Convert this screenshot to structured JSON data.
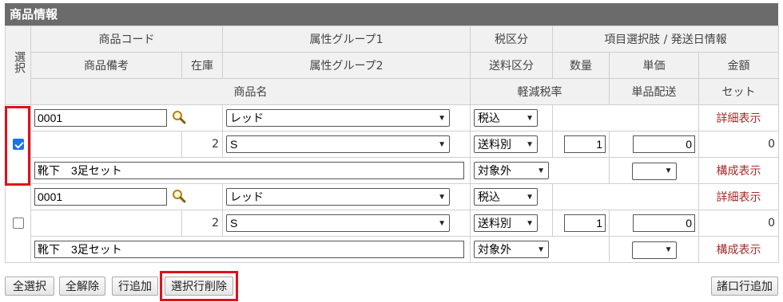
{
  "section_title": "商品情報",
  "headers": {
    "select": "選択",
    "product_code": "商品コード",
    "attr_group1": "属性グループ1",
    "tax_class": "税区分",
    "option_info": "項目選択肢 / 発送日情報",
    "product_note": "商品備考",
    "stock": "在庫",
    "attr_group2": "属性グループ2",
    "shipping_class": "送料区分",
    "quantity": "数量",
    "unit_price": "単価",
    "amount": "金額",
    "product_name": "商品名",
    "reduced_tax": "軽減税率",
    "single_ship": "単品配送",
    "set": "セット"
  },
  "rows": [
    {
      "checked": true,
      "code": "0001",
      "attr1": "レッド",
      "tax": "税込",
      "detail_link": "詳細表示",
      "stock": "2",
      "attr2": "S",
      "shipping": "送料別",
      "quantity": "1",
      "unit_price": "0",
      "amount": "0",
      "name": "靴下　3足セット",
      "reduced": "対象外",
      "single_ship": "",
      "compose_link": "構成表示"
    },
    {
      "checked": false,
      "code": "0001",
      "attr1": "レッド",
      "tax": "税込",
      "detail_link": "詳細表示",
      "stock": "2",
      "attr2": "S",
      "shipping": "送料別",
      "quantity": "1",
      "unit_price": "0",
      "amount": "0",
      "name": "靴下　3足セット",
      "reduced": "対象外",
      "single_ship": "",
      "compose_link": "構成表示"
    }
  ],
  "buttons": {
    "select_all": "全選択",
    "deselect_all": "全解除",
    "add_row": "行追加",
    "delete_selected": "選択行削除",
    "add_misc_row": "諸口行追加"
  },
  "colors": {
    "title_bg": "#6b6b6b",
    "link": "#a52a2a",
    "highlight": "#e0101b"
  }
}
